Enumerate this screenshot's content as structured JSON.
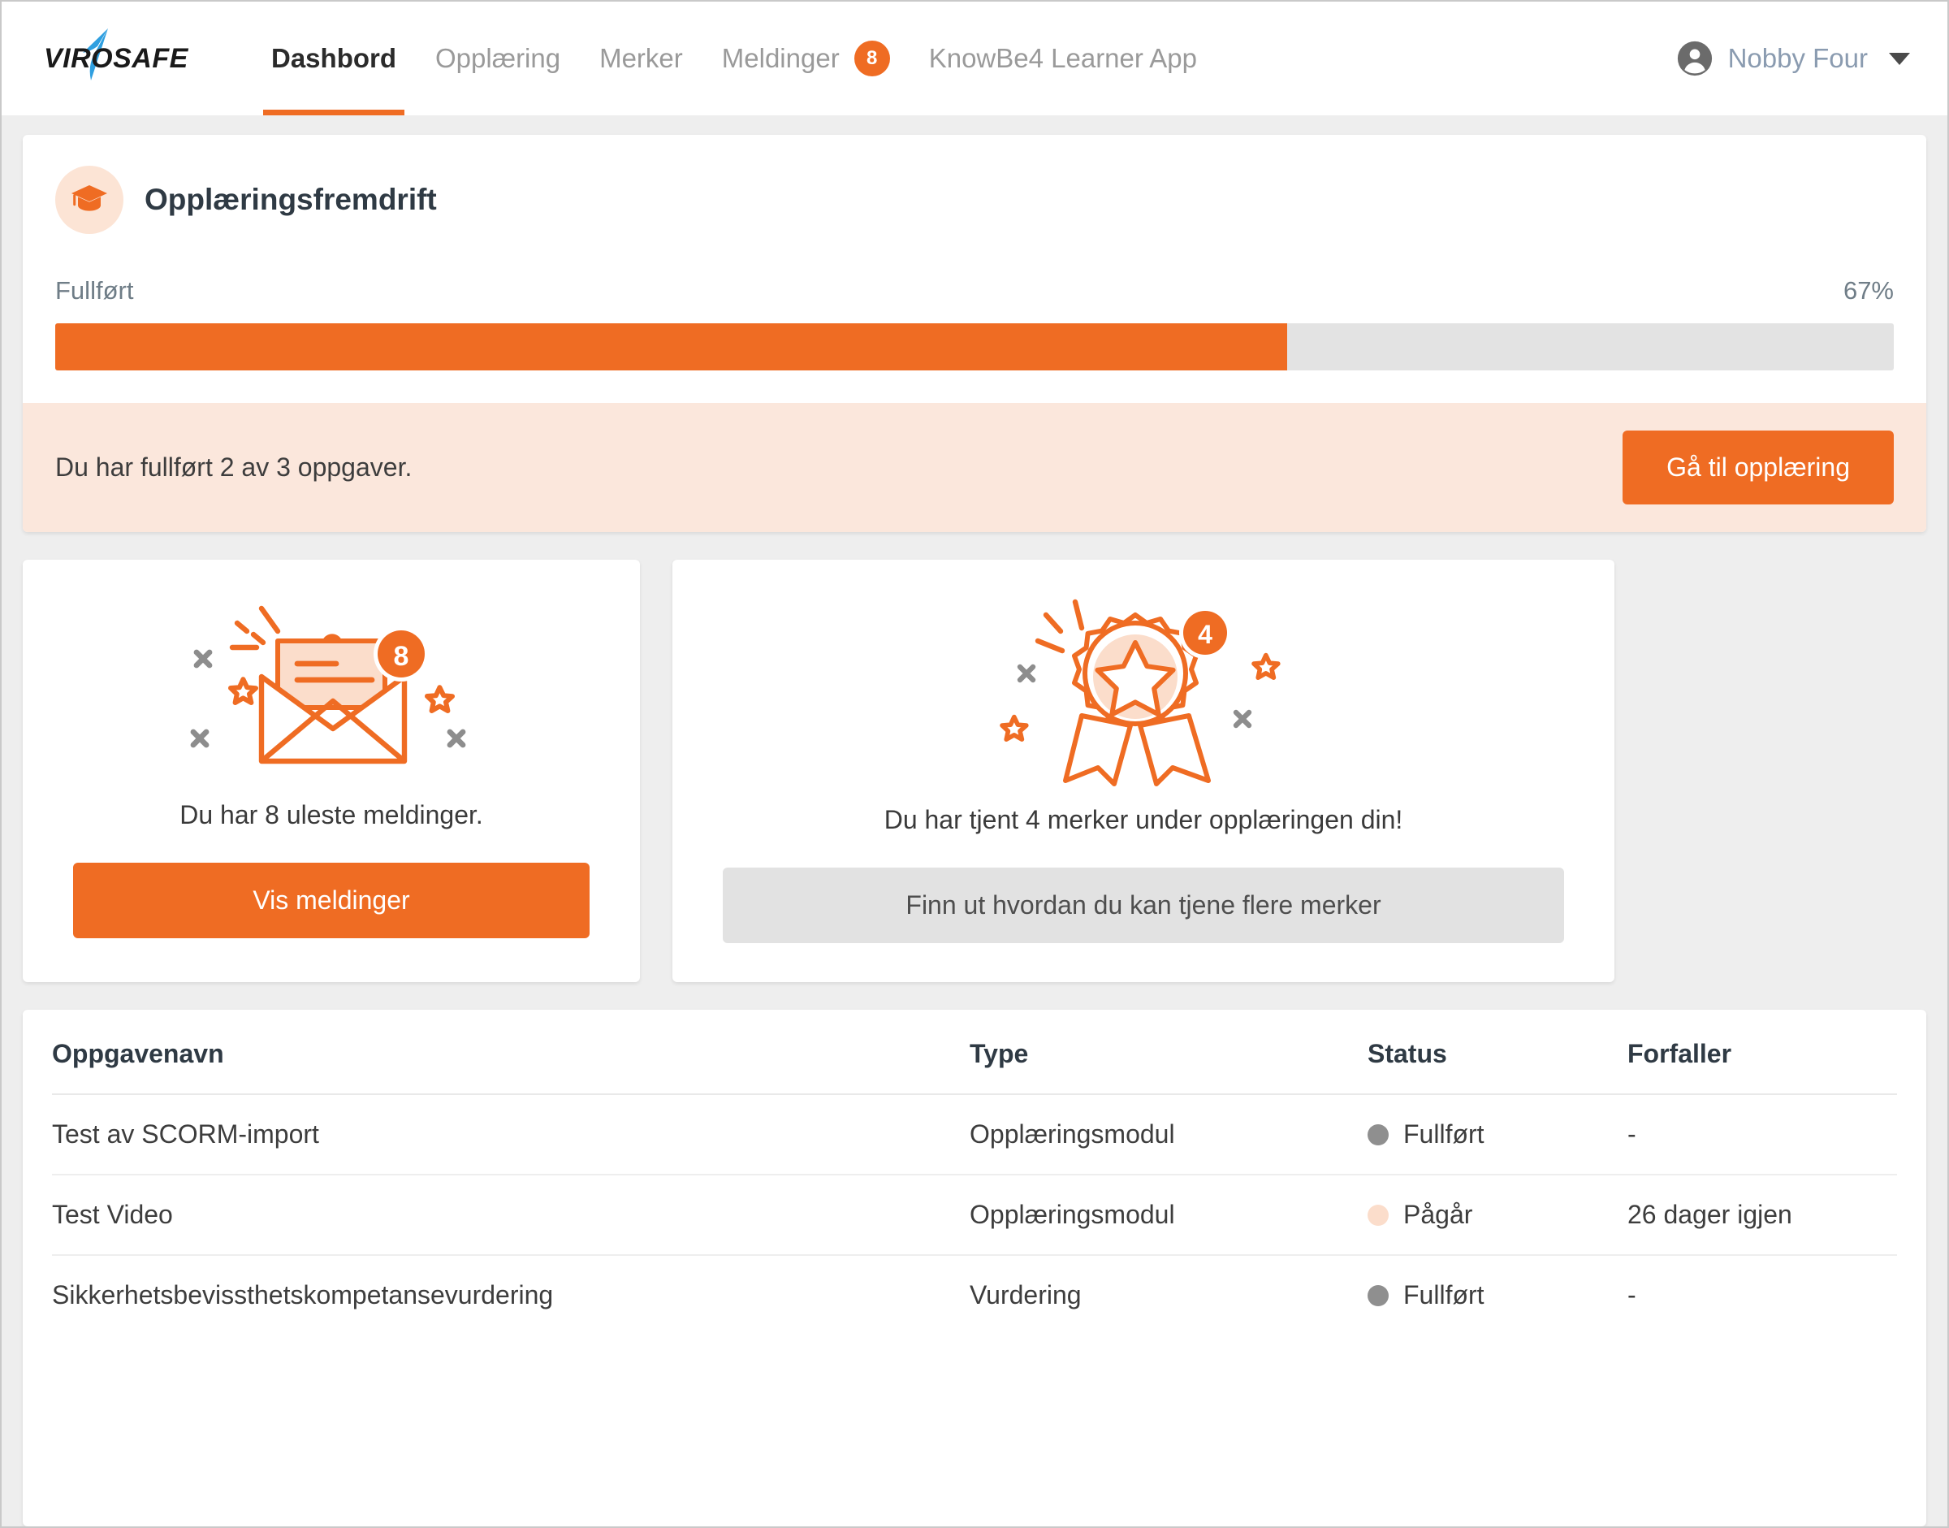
{
  "header": {
    "logo_text": "VIROSAFE",
    "nav": [
      {
        "label": "Dashbord",
        "active": true,
        "badge": null
      },
      {
        "label": "Opplæring",
        "active": false,
        "badge": null
      },
      {
        "label": "Merker",
        "active": false,
        "badge": null
      },
      {
        "label": "Meldinger",
        "active": false,
        "badge": "8"
      },
      {
        "label": "KnowBe4 Learner App",
        "active": false,
        "badge": null
      }
    ],
    "user": {
      "name": "Nobby Four",
      "icon": "account-circle-icon",
      "caret": "chevron-down-icon"
    }
  },
  "progress_card": {
    "icon": "graduation-cap-icon",
    "title": "Opplæringsfremdrift",
    "label": "Fullført",
    "percent_text": "67%",
    "percent_value": 67,
    "alert_text": "Du har fullført 2 av 3 oppgaver.",
    "alert_button": "Gå til opplæring"
  },
  "messages_card": {
    "illustration": "open-envelope-icon",
    "badge": "8",
    "text": "Du har 8 uleste meldinger.",
    "button": "Vis meldinger"
  },
  "badges_card": {
    "illustration": "award-medal-icon",
    "badge": "4",
    "text": "Du har tjent 4 merker under opplæringen din!",
    "button": "Finn ut hvordan du kan tjene flere merker"
  },
  "table": {
    "columns": [
      "Oppgavenavn",
      "Type",
      "Status",
      "Forfaller"
    ],
    "rows": [
      {
        "name": "Test av SCORM-import",
        "type": "Opplæringsmodul",
        "status": "Fullført",
        "status_color": "#8f8f8f",
        "due": "-"
      },
      {
        "name": "Test Video",
        "type": "Opplæringsmodul",
        "status": "Pågår",
        "status_color": "#fbddcb",
        "due": "26 dager igjen"
      },
      {
        "name": "Sikkerhetsbevissthetskompetansevurdering",
        "type": "Vurdering",
        "status": "Fullført",
        "status_color": "#8f8f8f",
        "due": "-"
      }
    ]
  },
  "colors": {
    "accent": "#ef6c23",
    "accent_soft": "#fbe7dc",
    "page_bg": "#eeeeee",
    "logo_blue": "#2f9fe0"
  }
}
